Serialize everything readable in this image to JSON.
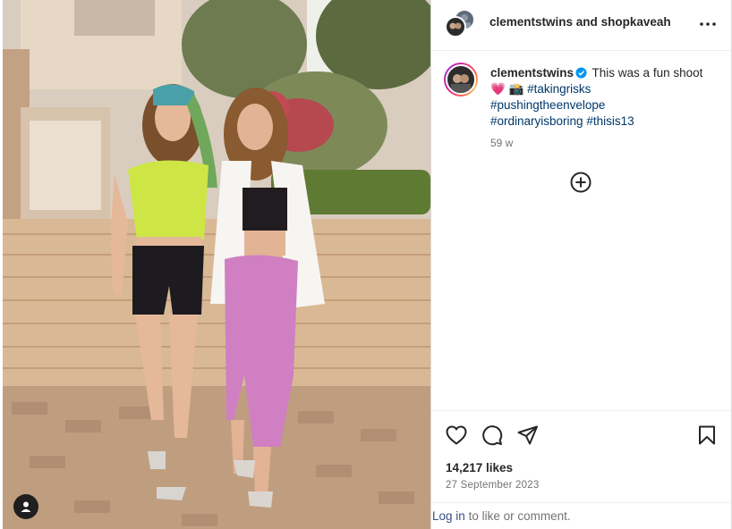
{
  "post": {
    "header": {
      "collab_user_1": "clementstwins",
      "collab_joiner": "and",
      "collab_user_2": "shopkaveah",
      "more_icon": "more-horizontal-icon"
    },
    "caption": {
      "username": "clementstwins",
      "verified_icon": "verified-badge-icon",
      "text": "This was a fun shoot",
      "emojis": "💗 📸",
      "hashtags": [
        "#takingrisks",
        "#pushingtheenvelope",
        "#ordinaryisboring",
        "#thisis13"
      ],
      "time_ago": "59 w"
    },
    "actions": {
      "like_icon": "heart-icon",
      "comment_icon": "comment-icon",
      "share_icon": "share-icon",
      "save_icon": "bookmark-icon",
      "add_comment_icon": "plus-circle-icon"
    },
    "likes": "14,217 likes",
    "date": "27 September 2023",
    "login_prompt": {
      "link_text": "Log in",
      "rest_text": "to like or comment."
    },
    "photo": {
      "user_tag_icon": "user-tag-icon"
    }
  },
  "colors": {
    "link": "#00376b",
    "muted": "#737373",
    "text": "#262626",
    "verified": "#0095f6",
    "border": "#dbdbdb"
  }
}
